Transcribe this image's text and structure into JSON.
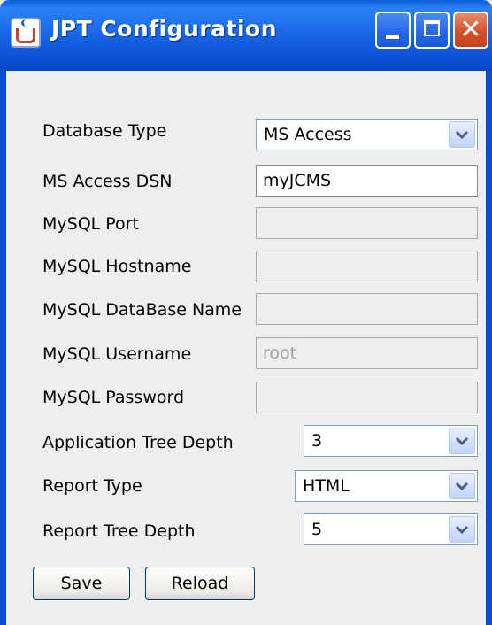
{
  "window": {
    "title": "JPT Configuration",
    "close_glyph": "✕"
  },
  "form": {
    "database_type": {
      "label": "Database Type",
      "value": "MS Access"
    },
    "ms_access_dsn": {
      "label": "MS Access DSN",
      "value": "myJCMS"
    },
    "mysql_port": {
      "label": "MySQL Port",
      "value": ""
    },
    "mysql_hostname": {
      "label": "MySQL Hostname",
      "value": ""
    },
    "mysql_database_name": {
      "label": "MySQL DataBase Name",
      "value": ""
    },
    "mysql_username": {
      "label": "MySQL Username",
      "value": "root"
    },
    "mysql_password": {
      "label": "MySQL Password",
      "value": ""
    },
    "application_tree_depth": {
      "label": "Application Tree Depth",
      "value": "3"
    },
    "report_type": {
      "label": "Report Type",
      "value": "HTML"
    },
    "report_tree_depth": {
      "label": "Report Tree Depth",
      "value": "5"
    }
  },
  "buttons": {
    "save": "Save",
    "reload": "Reload"
  },
  "colors": {
    "titlebar": "#1765e6",
    "close_button": "#d5502b",
    "client_bg": "#eeeeee"
  }
}
